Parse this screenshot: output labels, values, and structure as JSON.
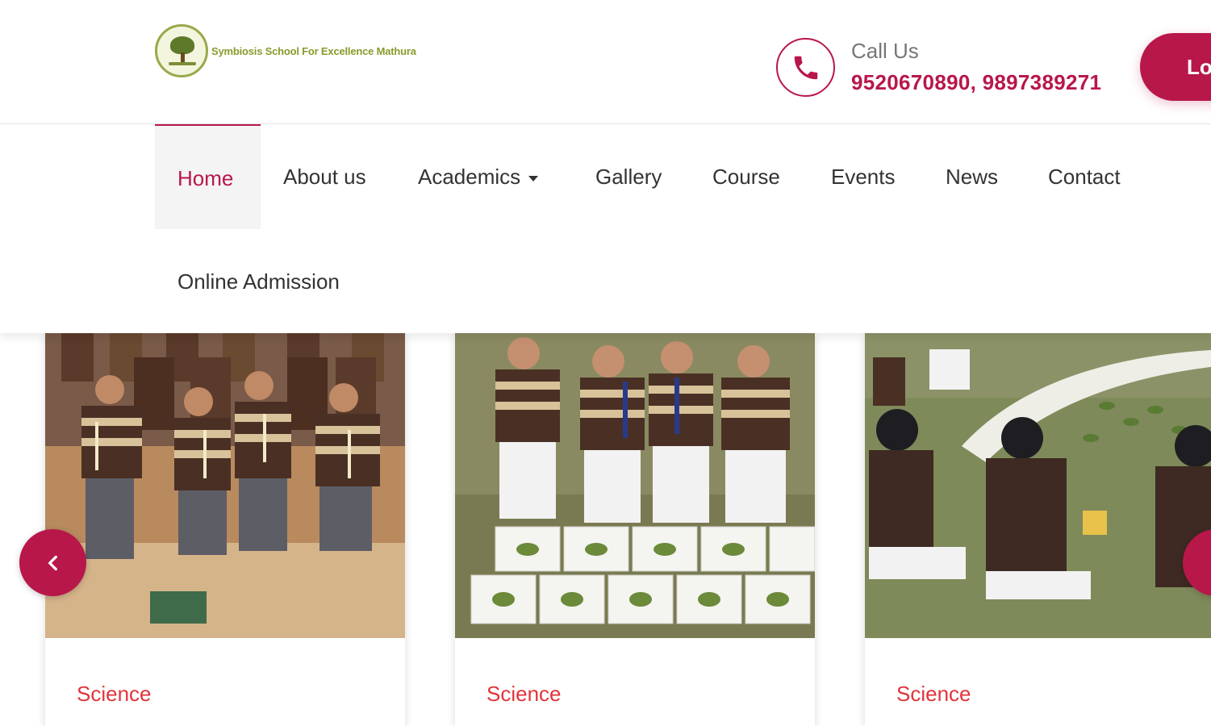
{
  "header": {
    "logo_text": "Symbiosis School For Excellence Mathura",
    "call_label": "Call Us",
    "call_numbers": "9520670890, 9897389271",
    "login_label": "Lo"
  },
  "nav": {
    "items": [
      {
        "label": "Home",
        "active": true
      },
      {
        "label": "About us"
      },
      {
        "label": "Academics",
        "has_dropdown": true
      },
      {
        "label": "Gallery"
      },
      {
        "label": "Course"
      },
      {
        "label": "Events"
      },
      {
        "label": "News"
      },
      {
        "label": "Contact"
      },
      {
        "label": "Online Admission"
      }
    ]
  },
  "cards": [
    {
      "category": "Science",
      "image": "students-kneeling-with-candles"
    },
    {
      "category": "Science",
      "image": "students-with-leaf-collection-books"
    },
    {
      "category": "Science",
      "image": "students-sitting-on-grass-with-leaves"
    }
  ],
  "carousel": {
    "prev_icon": "chevron-left-icon",
    "next_icon": "chevron-right-icon"
  },
  "colors": {
    "accent": "#b8174a",
    "category": "#e1343a",
    "logo_green": "#8a9a2c"
  }
}
